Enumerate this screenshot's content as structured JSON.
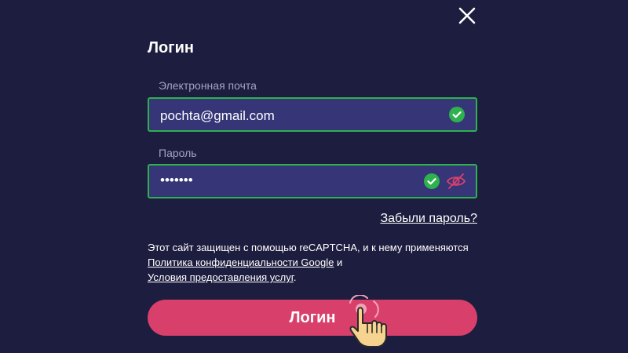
{
  "modal": {
    "title": "Логин",
    "email": {
      "label": "Электронная почта",
      "value": "pochta@gmail.com",
      "status_icon": "check-circle-icon"
    },
    "password": {
      "label": "Пароль",
      "value": "•••••••",
      "status_icon": "check-circle-icon",
      "visibility_icon": "eye-slash-icon"
    },
    "forgot_password": "Забыли пароль?",
    "recaptcha_notice": {
      "text_before": "Этот сайт защищен с помощью reCAPTCHA, и к нему применяются",
      "privacy_link": "Политика конфиденциальности Google",
      "conjunction": "и",
      "terms_link": "Условия предоставления услуг",
      "end": "."
    },
    "submit_label": "Логин"
  },
  "colors": {
    "background": "#1d1d3f",
    "field_background": "#353577",
    "valid_border": "#2db24d",
    "button": "#d8406b",
    "eye_icon": "#d8406b"
  }
}
